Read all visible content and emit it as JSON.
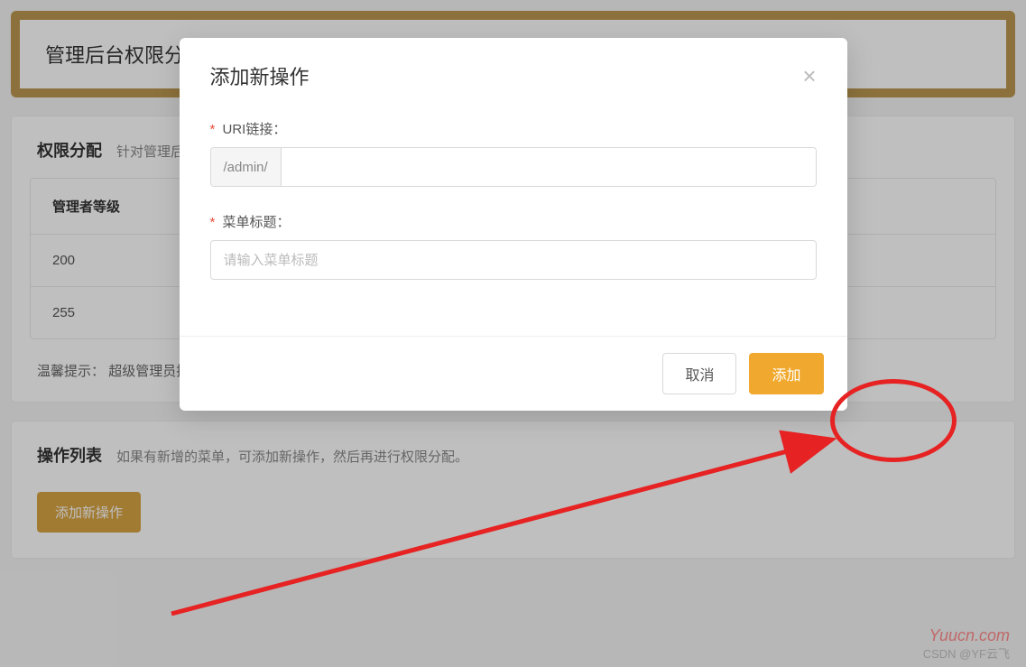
{
  "page": {
    "header_title": "管理后台权限分配",
    "permissions": {
      "title": "权限分配",
      "subtitle": "针对管理后台的项",
      "col_header": "管理者等级",
      "rows": [
        "200",
        "255"
      ],
      "tip_label": "温馨提示：",
      "tip_text": "超级管理员拥有全部操"
    },
    "ops": {
      "title": "操作列表",
      "subtitle": "如果有新增的菜单，可添加新操作，然后再进行权限分配。",
      "add_button": "添加新操作"
    }
  },
  "modal": {
    "title": "添加新操作",
    "uri_label": "URI链接：",
    "uri_prefix": "/admin/",
    "menu_label": "菜单标题：",
    "menu_placeholder": "请输入菜单标题",
    "cancel": "取消",
    "confirm": "添加"
  },
  "watermarks": {
    "site": "Yuucn.com",
    "credit": "CSDN @YF云飞"
  }
}
